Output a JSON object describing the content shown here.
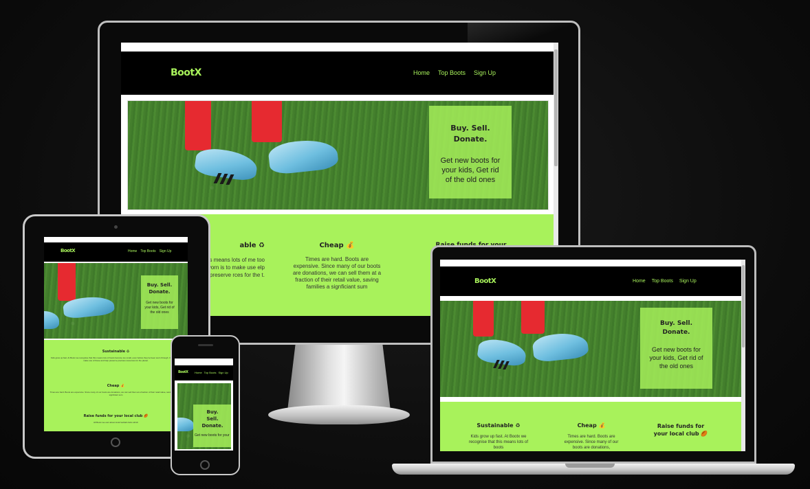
{
  "site": {
    "logo": "BootX",
    "nav": [
      "Home",
      "Top Boots",
      "Sign Up"
    ],
    "hero": {
      "title_line1": "Buy. Sell.",
      "title_line2": "Donate.",
      "tagline": "Get new boots for your kids, Get rid of the old ones"
    },
    "features": [
      {
        "title": "Sustainable ♻",
        "text": "Kids grow up fast. At Bootx we recognise that this means lots of boots become too small, even before they've been worn through. Our aim is to make use of these and help preserve precious resources for the planet."
      },
      {
        "title": "Cheap 💰",
        "text": "Times are hard. Boots are expensive. Since many of our boots are donations, we can sell them at a fraction of their retail value, saving families a signficiant sum"
      },
      {
        "title": "Raise funds for your local club 🏉",
        "text": "All Bootx we own about local football clubs which..."
      }
    ],
    "desktop_feat1_title": "able ♻",
    "desktop_feat1_text": ". At Bootx we s means lots of me too small, 've been worn is to make use elp preserve rces for the t.",
    "desktop_feat3_title": "Raise funds for your",
    "tablet_hero_title": "Buy. Sell. Donate.",
    "tablet_hero_text": "Get new boots for your kids, Get rid of the old ones",
    "tablet_feat1": "Sustainable ♻",
    "tablet_feat1_text": "Kids grow up fast. At Bootx we recognise that this means lots of boots become too small, even before they've been worn through. Our aim is to make use of these and help preserve precious resources for the planet.",
    "tablet_feat2": "Cheap 💰",
    "tablet_feat2_text": "Times are hard. Boots are expensive. Since many of our boots are donations, we can sell them at a fraction of their retail value, saving families a signficiant sum",
    "tablet_feat3": "Raise funds for your local club 🏉",
    "tablet_feat3_text": "All Bootx we own about local football clubs which",
    "phone_hero_title": "Buy. Sell. Donate.",
    "phone_hero_text": "Get new boots for your kids, Get ri",
    "laptop_feat1_title": "Sustainable ♻",
    "laptop_feat1_text": "Kids grow up fast. At Bootx we recognise that this means lots of boots",
    "laptop_feat2_title": "Cheap 💰",
    "laptop_feat2_text": "Times are hard. Boots are expensive. Since many of our boots are donations,",
    "laptop_feat3_title": "Raise funds for your local club 🏉"
  },
  "colors": {
    "accent": "#a8f25b",
    "nav_bg": "#000000",
    "page_bg": "#0c0c0c"
  }
}
